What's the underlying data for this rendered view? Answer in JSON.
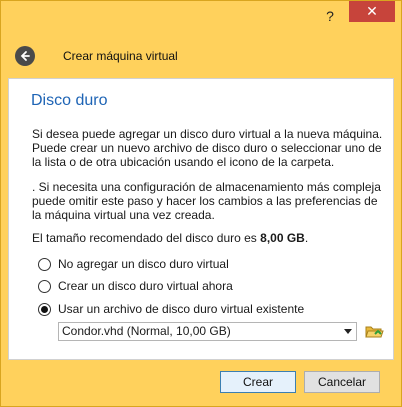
{
  "titlebar": {
    "help": "?",
    "close": "✕"
  },
  "header": {
    "title": "Crear máquina virtual"
  },
  "section": {
    "title": "Disco duro",
    "paragraph1": "Si desea puede agregar un disco duro virtual a la nueva máquina. Puede crear un nuevo archivo de disco duro o seleccionar uno de la lista o de otra ubicación usando el icono de la carpeta.",
    "paragraph2": ". Si necesita una configuración de almacenamiento más compleja puede omitir este paso y hacer los cambios a las preferencias de la máquina virtual una vez creada.",
    "recommended_prefix": "El tamaño recomendado del disco duro es ",
    "recommended_size": "8,00 GB",
    "recommended_suffix": "."
  },
  "options": [
    {
      "label": "No agregar un disco duro virtual",
      "selected": false
    },
    {
      "label": "Crear un disco duro virtual ahora",
      "selected": false
    },
    {
      "label": "Usar un archivo de disco duro virtual existente",
      "selected": true
    }
  ],
  "disk_select": {
    "value": "Condor.vhd (Normal, 10,00 GB)"
  },
  "buttons": {
    "create": "Crear",
    "cancel": "Cancelar"
  },
  "colors": {
    "frame": "#ffd15c",
    "close": "#c7443b",
    "heading": "#1e64b5"
  }
}
